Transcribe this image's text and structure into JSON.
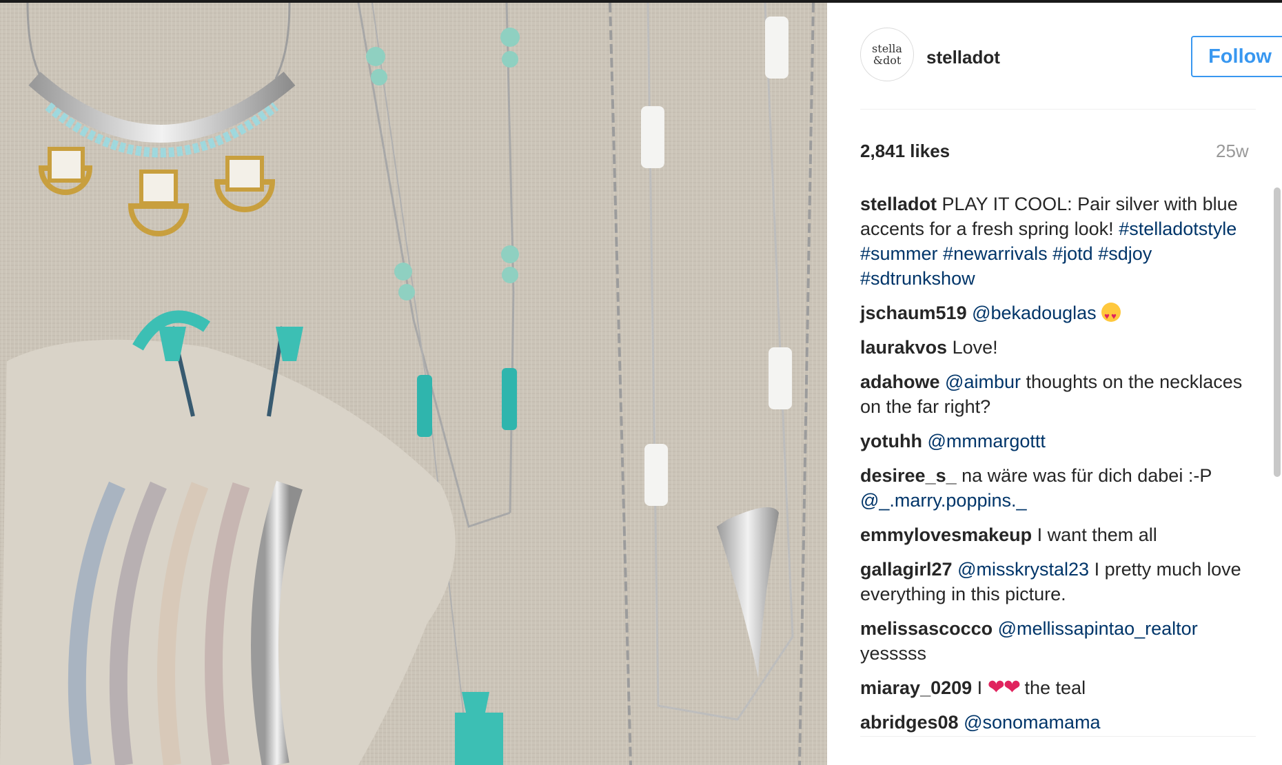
{
  "post": {
    "username": "stelladot",
    "avatar_text_line1": "stella",
    "avatar_text_line2": "&dot",
    "follow_label": "Follow",
    "likes": "2,841 likes",
    "age": "25w",
    "caption": {
      "user": "stelladot",
      "text": "PLAY IT COOL: Pair silver with blue accents for a fresh spring look!",
      "tags": [
        "#stelladotstyle",
        "#summer",
        "#newarrivals",
        "#jotd",
        "#sdjoy",
        "#sdtrunkshow"
      ]
    }
  },
  "comments": [
    {
      "user": "jschaum519",
      "mention": "@bekadouglas",
      "text": "",
      "emoji": "heart-eyes"
    },
    {
      "user": "laurakvos",
      "mention": "",
      "text": "Love!"
    },
    {
      "user": "adahowe",
      "mention": "@aimbur",
      "text": "thoughts on the necklaces on the far right?"
    },
    {
      "user": "yotuhh",
      "mention": "@mmmargottt",
      "text": ""
    },
    {
      "user": "desiree_s_",
      "mention": "",
      "text": "na wäre was für dich dabei :-P",
      "mention_after": "@_.marry.poppins._"
    },
    {
      "user": "emmylovesmakeup",
      "mention": "",
      "text": "I want them all"
    },
    {
      "user": "gallagirl27",
      "mention": "@misskrystal23",
      "text": "I pretty much love everything in this picture."
    },
    {
      "user": "melissascocco",
      "mention": "@mellissapintao_realtor",
      "text": "yesssss"
    },
    {
      "user": "miaray_0209",
      "mention": "",
      "text_before": "I",
      "hearts": "❤❤",
      "text": "the teal"
    },
    {
      "user": "abridges08",
      "mention": "@sonomamama",
      "text": ""
    }
  ],
  "colors": {
    "accent": "#3897f0",
    "link": "#003569",
    "text": "#262626",
    "muted": "#999999",
    "turquoise": "#3cbfb4",
    "gold": "#d8b24a",
    "linen": "#cdc6ba"
  }
}
